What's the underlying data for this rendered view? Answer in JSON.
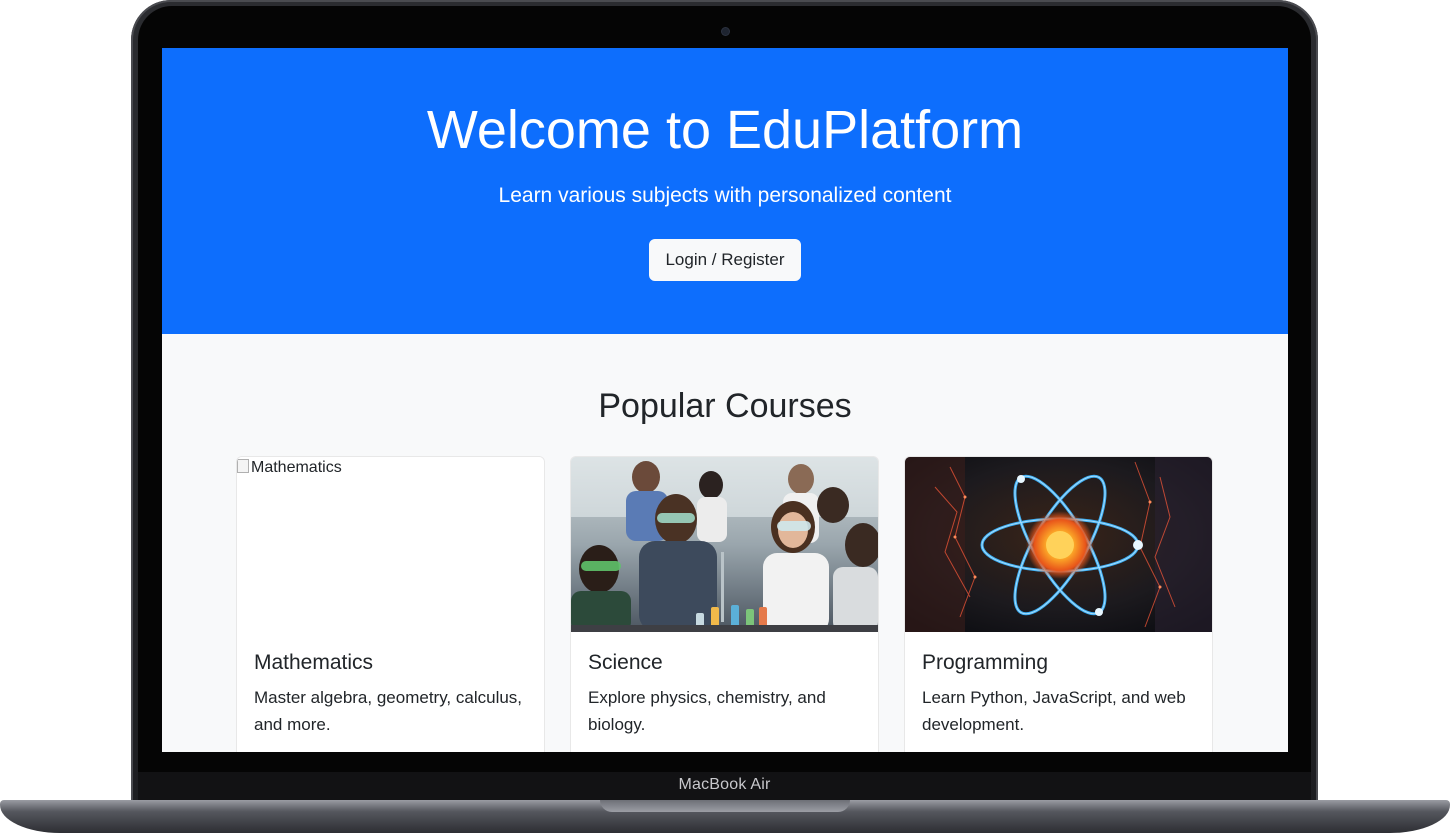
{
  "device": {
    "label": "MacBook Air"
  },
  "hero": {
    "title": "Welcome to EduPlatform",
    "subtitle": "Learn various subjects with personalized content",
    "button_label": "Login / Register",
    "background_color": "#0d6efd"
  },
  "courses_section": {
    "title": "Popular Courses",
    "cards": [
      {
        "image_alt": "Mathematics",
        "image_state": "broken",
        "title": "Mathematics",
        "description": "Master algebra, geometry, calculus, and more."
      },
      {
        "image_alt": "Science",
        "image_state": "photo-students-in-lab",
        "title": "Science",
        "description": "Explore physics, chemistry, and biology."
      },
      {
        "image_alt": "Programming",
        "image_state": "illustration-glowing-atom",
        "title": "Programming",
        "description": "Learn Python, JavaScript, and web development."
      }
    ]
  }
}
